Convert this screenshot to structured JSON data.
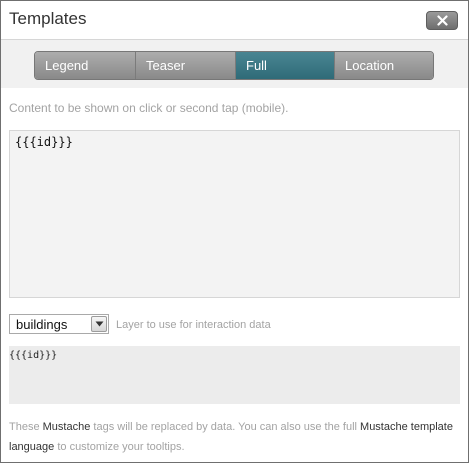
{
  "dialog": {
    "title": "Templates",
    "close_icon": "close-icon"
  },
  "tabs": [
    {
      "label": "Legend",
      "active": false
    },
    {
      "label": "Teaser",
      "active": false
    },
    {
      "label": "Full",
      "active": true
    },
    {
      "label": "Location",
      "active": false
    }
  ],
  "content_hint": "Content to be shown on click or second tap (mobile).",
  "editor": {
    "value": "{{{id}}}"
  },
  "layer_select": {
    "value": "buildings",
    "hint": "Layer to use for interaction data"
  },
  "preview": {
    "text": "{{{id}}}"
  },
  "footer": {
    "part1": "These ",
    "mustache_link": "Mustache",
    "part2": " tags will be replaced by data. You can also use the full ",
    "template_link": "Mustache template language",
    "part3": " to customize your tooltips."
  },
  "colors": {
    "active_tab": "#3b7a87",
    "inactive_tab": "#9b9b9b"
  }
}
